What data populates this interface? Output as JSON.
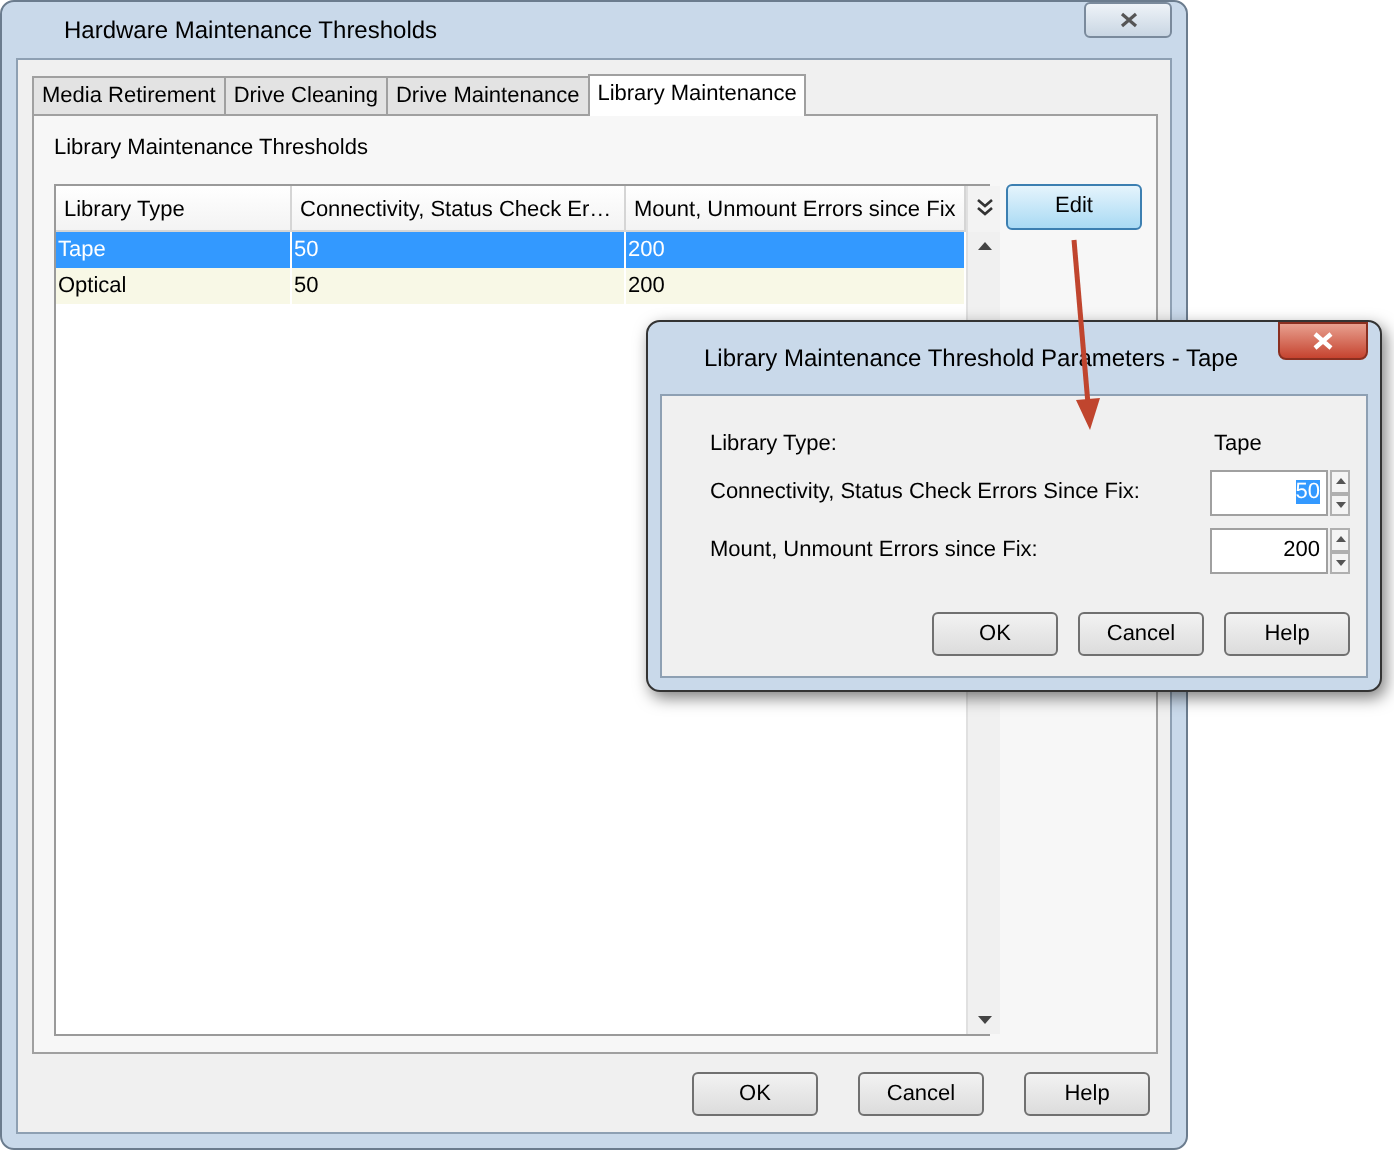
{
  "window": {
    "title": "Hardware Maintenance Thresholds"
  },
  "tabs": [
    {
      "label": "Media Retirement",
      "selected": false
    },
    {
      "label": "Drive Cleaning",
      "selected": false
    },
    {
      "label": "Drive Maintenance",
      "selected": false
    },
    {
      "label": "Library Maintenance",
      "selected": true
    }
  ],
  "panel": {
    "title": "Library Maintenance Thresholds"
  },
  "table": {
    "columns": [
      "Library Type",
      "Connectivity, Status Check Er…",
      "Mount, Unmount Errors since Fix"
    ],
    "rows": [
      {
        "cells": [
          "Tape",
          "50",
          "200"
        ],
        "selected": true
      },
      {
        "cells": [
          "Optical",
          "50",
          "200"
        ],
        "selected": false
      }
    ]
  },
  "edit_button": "Edit",
  "buttons": [
    "OK",
    "Cancel",
    "Help"
  ],
  "dialog": {
    "title": "Library Maintenance Threshold Parameters - Tape",
    "fields": [
      {
        "kind": "static",
        "label": "Library Type:",
        "value": "Tape"
      },
      {
        "kind": "spinner",
        "label": "Connectivity, Status Check Errors Since Fix:",
        "value": "50",
        "selected": true
      },
      {
        "kind": "spinner",
        "label": "Mount, Unmount Errors since Fix:",
        "value": "200",
        "selected": false
      }
    ],
    "buttons": [
      "OK",
      "Cancel",
      "Help"
    ]
  }
}
